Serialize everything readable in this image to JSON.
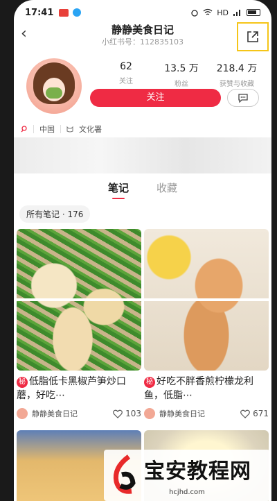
{
  "status_bar": {
    "time": "17:41",
    "network": "HD"
  },
  "header": {
    "back_glyph": "‹",
    "title": "静静美食日记",
    "subtitle": "小红书号：112835103"
  },
  "profile": {
    "stats": [
      {
        "value": "62",
        "label": "关注"
      },
      {
        "value": "13.5 万",
        "label": "粉丝"
      },
      {
        "value": "218.4 万",
        "label": "获赞与收藏"
      }
    ],
    "follow_label": "关注"
  },
  "tags": [
    {
      "icon": "location-icon",
      "text": "中国"
    },
    {
      "icon": "cat-icon",
      "text": "文化署"
    }
  ],
  "tabs": [
    {
      "label": "笔记",
      "active": true
    },
    {
      "label": "收藏",
      "active": false
    }
  ],
  "filter": {
    "label": "所有笔记 · 176"
  },
  "notes": [
    {
      "badge": "秘",
      "title": "低脂低卡黑椒芦笋炒口蘑，好吃⋯",
      "author": "静静美食日记",
      "likes": "103"
    },
    {
      "badge": "秘",
      "title": "好吃不胖香煎柠檬龙利鱼，低脂⋯",
      "author": "静静美食日记",
      "likes": "671"
    }
  ],
  "watermark": {
    "title": "宝安教程网",
    "url": "hcjhd.com"
  },
  "colors": {
    "accent": "#ef2b44",
    "highlight_box": "#f5c518"
  }
}
